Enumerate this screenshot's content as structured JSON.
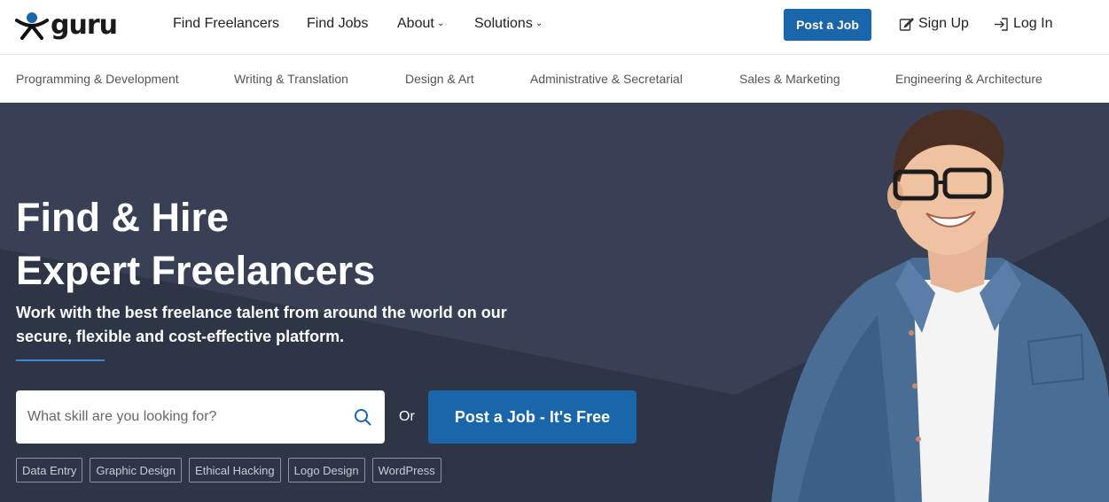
{
  "brand": {
    "name": "guru"
  },
  "nav": {
    "items": [
      {
        "label": "Find Freelancers",
        "dropdown": false
      },
      {
        "label": "Find Jobs",
        "dropdown": false
      },
      {
        "label": "About",
        "dropdown": true
      },
      {
        "label": "Solutions",
        "dropdown": true
      }
    ],
    "post_job": "Post a Job",
    "sign_up": "Sign Up",
    "log_in": "Log In"
  },
  "categories": [
    "Programming & Development",
    "Writing & Translation",
    "Design & Art",
    "Administrative & Secretarial",
    "Sales & Marketing",
    "Engineering & Architecture"
  ],
  "hero": {
    "title_line1": "Find & Hire",
    "title_line2": "Expert Freelancers",
    "subtitle": "Work with the best freelance talent from around the world on our secure, flexible and cost-effective platform.",
    "search_placeholder": "What skill are you looking for?",
    "or_text": "Or",
    "cta": "Post a Job - It's Free",
    "tags": [
      "Data Entry",
      "Graphic Design",
      "Ethical Hacking",
      "Logo Design",
      "WordPress"
    ]
  },
  "colors": {
    "primary": "#1a66aa",
    "hero_bg": "#2e3547",
    "accent_line": "#3a8ad8"
  },
  "icons": {
    "logo": "guru-figure-logo",
    "search": "search-icon",
    "sign_up": "edit-icon",
    "log_in": "login-icon",
    "dropdown": "chevron-down-icon"
  }
}
